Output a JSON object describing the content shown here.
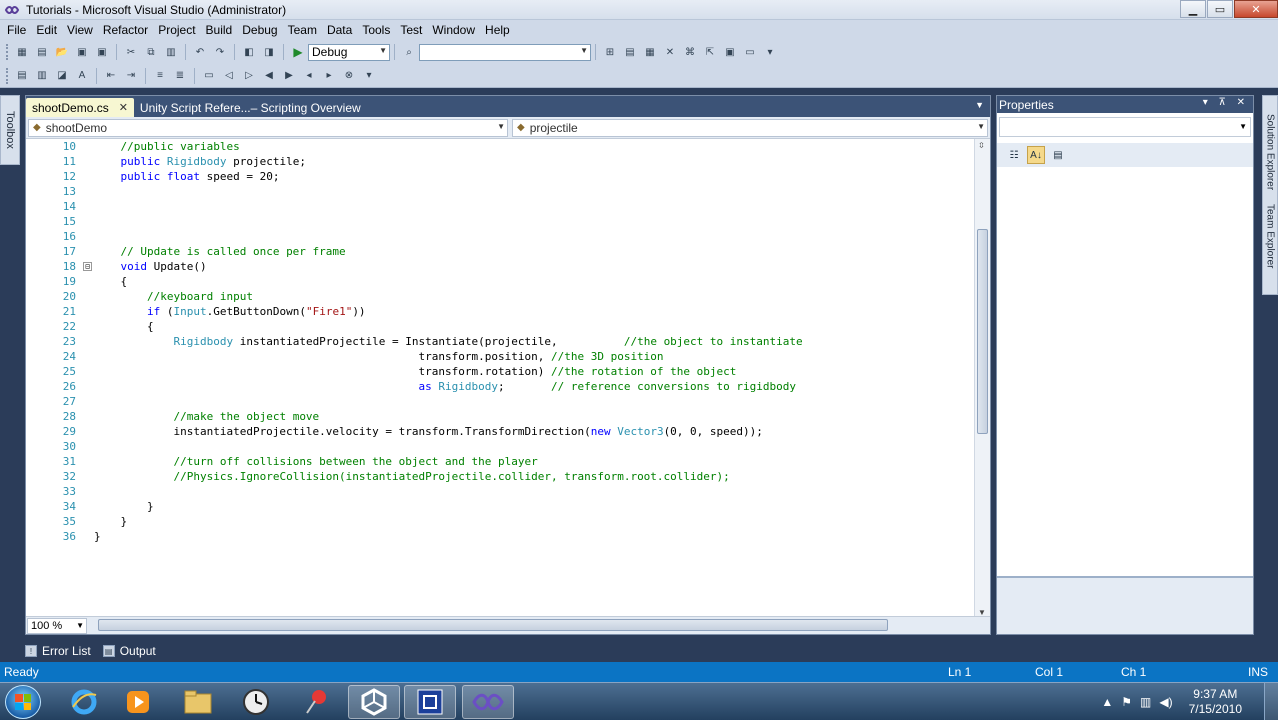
{
  "window": {
    "title": "Tutorials - Microsoft Visual Studio (Administrator)",
    "controls": [
      "minimize",
      "maximize",
      "close"
    ]
  },
  "menu": [
    "File",
    "Edit",
    "View",
    "Refactor",
    "Project",
    "Build",
    "Debug",
    "Team",
    "Data",
    "Tools",
    "Test",
    "Window",
    "Help"
  ],
  "toolbar": {
    "config_value": "Debug",
    "platform_value": ""
  },
  "left_strip": {
    "label": "Toolbox"
  },
  "editor": {
    "tabs": [
      {
        "label": "shootDemo.cs",
        "active": true
      },
      {
        "label": "Unity Script Refere...– Scripting Overview",
        "active": false
      }
    ],
    "nav_left": "shootDemo",
    "nav_right": "projectile",
    "zoom": "100 %",
    "lines": [
      {
        "n": "10",
        "fold": "",
        "tokens": [
          {
            "t": "    ",
            "c": ""
          },
          {
            "t": "//public variables",
            "c": "cm"
          }
        ]
      },
      {
        "n": "11",
        "fold": "",
        "tokens": [
          {
            "t": "    ",
            "c": ""
          },
          {
            "t": "public",
            "c": "kw"
          },
          {
            "t": " ",
            "c": ""
          },
          {
            "t": "Rigidbody",
            "c": "ty"
          },
          {
            "t": " projectile;",
            "c": ""
          }
        ]
      },
      {
        "n": "12",
        "fold": "",
        "tokens": [
          {
            "t": "    ",
            "c": ""
          },
          {
            "t": "public",
            "c": "kw"
          },
          {
            "t": " ",
            "c": ""
          },
          {
            "t": "float",
            "c": "kw"
          },
          {
            "t": " speed = 20;",
            "c": ""
          }
        ]
      },
      {
        "n": "13",
        "fold": "",
        "tokens": []
      },
      {
        "n": "14",
        "fold": "",
        "tokens": []
      },
      {
        "n": "15",
        "fold": "",
        "tokens": []
      },
      {
        "n": "16",
        "fold": "",
        "tokens": []
      },
      {
        "n": "17",
        "fold": "",
        "tokens": [
          {
            "t": "    ",
            "c": ""
          },
          {
            "t": "// Update is called once per frame",
            "c": "cm"
          }
        ]
      },
      {
        "n": "18",
        "fold": "⊟",
        "tokens": [
          {
            "t": "    ",
            "c": ""
          },
          {
            "t": "void",
            "c": "kw"
          },
          {
            "t": " Update()",
            "c": ""
          }
        ]
      },
      {
        "n": "19",
        "fold": "",
        "tokens": [
          {
            "t": "    {",
            "c": ""
          }
        ]
      },
      {
        "n": "20",
        "fold": "",
        "tokens": [
          {
            "t": "        ",
            "c": ""
          },
          {
            "t": "//keyboard input",
            "c": "cm"
          }
        ]
      },
      {
        "n": "21",
        "fold": "",
        "tokens": [
          {
            "t": "        ",
            "c": ""
          },
          {
            "t": "if",
            "c": "kw"
          },
          {
            "t": " (",
            "c": ""
          },
          {
            "t": "Input",
            "c": "ty"
          },
          {
            "t": ".GetButtonDown(",
            "c": ""
          },
          {
            "t": "\"Fire1\"",
            "c": "st"
          },
          {
            "t": "))",
            "c": ""
          }
        ]
      },
      {
        "n": "22",
        "fold": "",
        "tokens": [
          {
            "t": "        {",
            "c": ""
          }
        ]
      },
      {
        "n": "23",
        "fold": "",
        "tokens": [
          {
            "t": "            ",
            "c": ""
          },
          {
            "t": "Rigidbody",
            "c": "ty"
          },
          {
            "t": " instantiatedProjectile = Instantiate(projectile,          ",
            "c": ""
          },
          {
            "t": "//the object to instantiate",
            "c": "cm"
          }
        ]
      },
      {
        "n": "24",
        "fold": "",
        "tokens": [
          {
            "t": "                                                 transform.position, ",
            "c": ""
          },
          {
            "t": "//the 3D position",
            "c": "cm"
          }
        ]
      },
      {
        "n": "25",
        "fold": "",
        "tokens": [
          {
            "t": "                                                 transform.rotation) ",
            "c": ""
          },
          {
            "t": "//the rotation of the object",
            "c": "cm"
          }
        ]
      },
      {
        "n": "26",
        "fold": "",
        "tokens": [
          {
            "t": "                                                 ",
            "c": ""
          },
          {
            "t": "as",
            "c": "kw"
          },
          {
            "t": " ",
            "c": ""
          },
          {
            "t": "Rigidbody",
            "c": "ty"
          },
          {
            "t": ";       ",
            "c": ""
          },
          {
            "t": "// reference conversions to rigidbody",
            "c": "cm"
          }
        ]
      },
      {
        "n": "27",
        "fold": "",
        "tokens": []
      },
      {
        "n": "28",
        "fold": "",
        "tokens": [
          {
            "t": "            ",
            "c": ""
          },
          {
            "t": "//make the object move",
            "c": "cm"
          }
        ]
      },
      {
        "n": "29",
        "fold": "",
        "tokens": [
          {
            "t": "            instantiatedProjectile.velocity = transform.TransformDirection(",
            "c": ""
          },
          {
            "t": "new",
            "c": "kw"
          },
          {
            "t": " ",
            "c": ""
          },
          {
            "t": "Vector3",
            "c": "ty"
          },
          {
            "t": "(0, 0, speed));",
            "c": ""
          }
        ]
      },
      {
        "n": "30",
        "fold": "",
        "tokens": []
      },
      {
        "n": "31",
        "fold": "",
        "tokens": [
          {
            "t": "            ",
            "c": ""
          },
          {
            "t": "//turn off collisions between the object and the player",
            "c": "cm"
          }
        ]
      },
      {
        "n": "32",
        "fold": "",
        "tokens": [
          {
            "t": "            ",
            "c": ""
          },
          {
            "t": "//Physics.IgnoreCollision(instantiatedProjectile.collider, transform.root.collider);",
            "c": "cm"
          }
        ]
      },
      {
        "n": "33",
        "fold": "",
        "tokens": []
      },
      {
        "n": "34",
        "fold": "",
        "tokens": [
          {
            "t": "        }",
            "c": ""
          }
        ]
      },
      {
        "n": "35",
        "fold": "",
        "tokens": [
          {
            "t": "    }",
            "c": ""
          }
        ]
      },
      {
        "n": "36",
        "fold": "",
        "tokens": [
          {
            "t": "}",
            "c": ""
          }
        ]
      }
    ]
  },
  "properties": {
    "title": "Properties",
    "header_buttons": "▾ ⊼ ✕"
  },
  "right_strip": [
    "Solution Explorer",
    "Team Explorer"
  ],
  "bottom_tabs": [
    "Error List",
    "Output"
  ],
  "status": {
    "ready": "Ready",
    "ln": "Ln 1",
    "col": "Col 1",
    "ch": "Ch 1",
    "mode": "INS"
  },
  "taskbar": {
    "apps": [
      "internet-explorer",
      "media-player",
      "file-explorer",
      "clock-app",
      "pin-app",
      "unity",
      "visual-studio-blue",
      "visual-studio"
    ],
    "time": "9:37 AM",
    "date": "7/15/2010"
  },
  "colors": {
    "keyword": "#0000ff",
    "type": "#2b91af",
    "comment": "#008000",
    "string": "#a31515",
    "status_bar": "#0b74c4"
  }
}
